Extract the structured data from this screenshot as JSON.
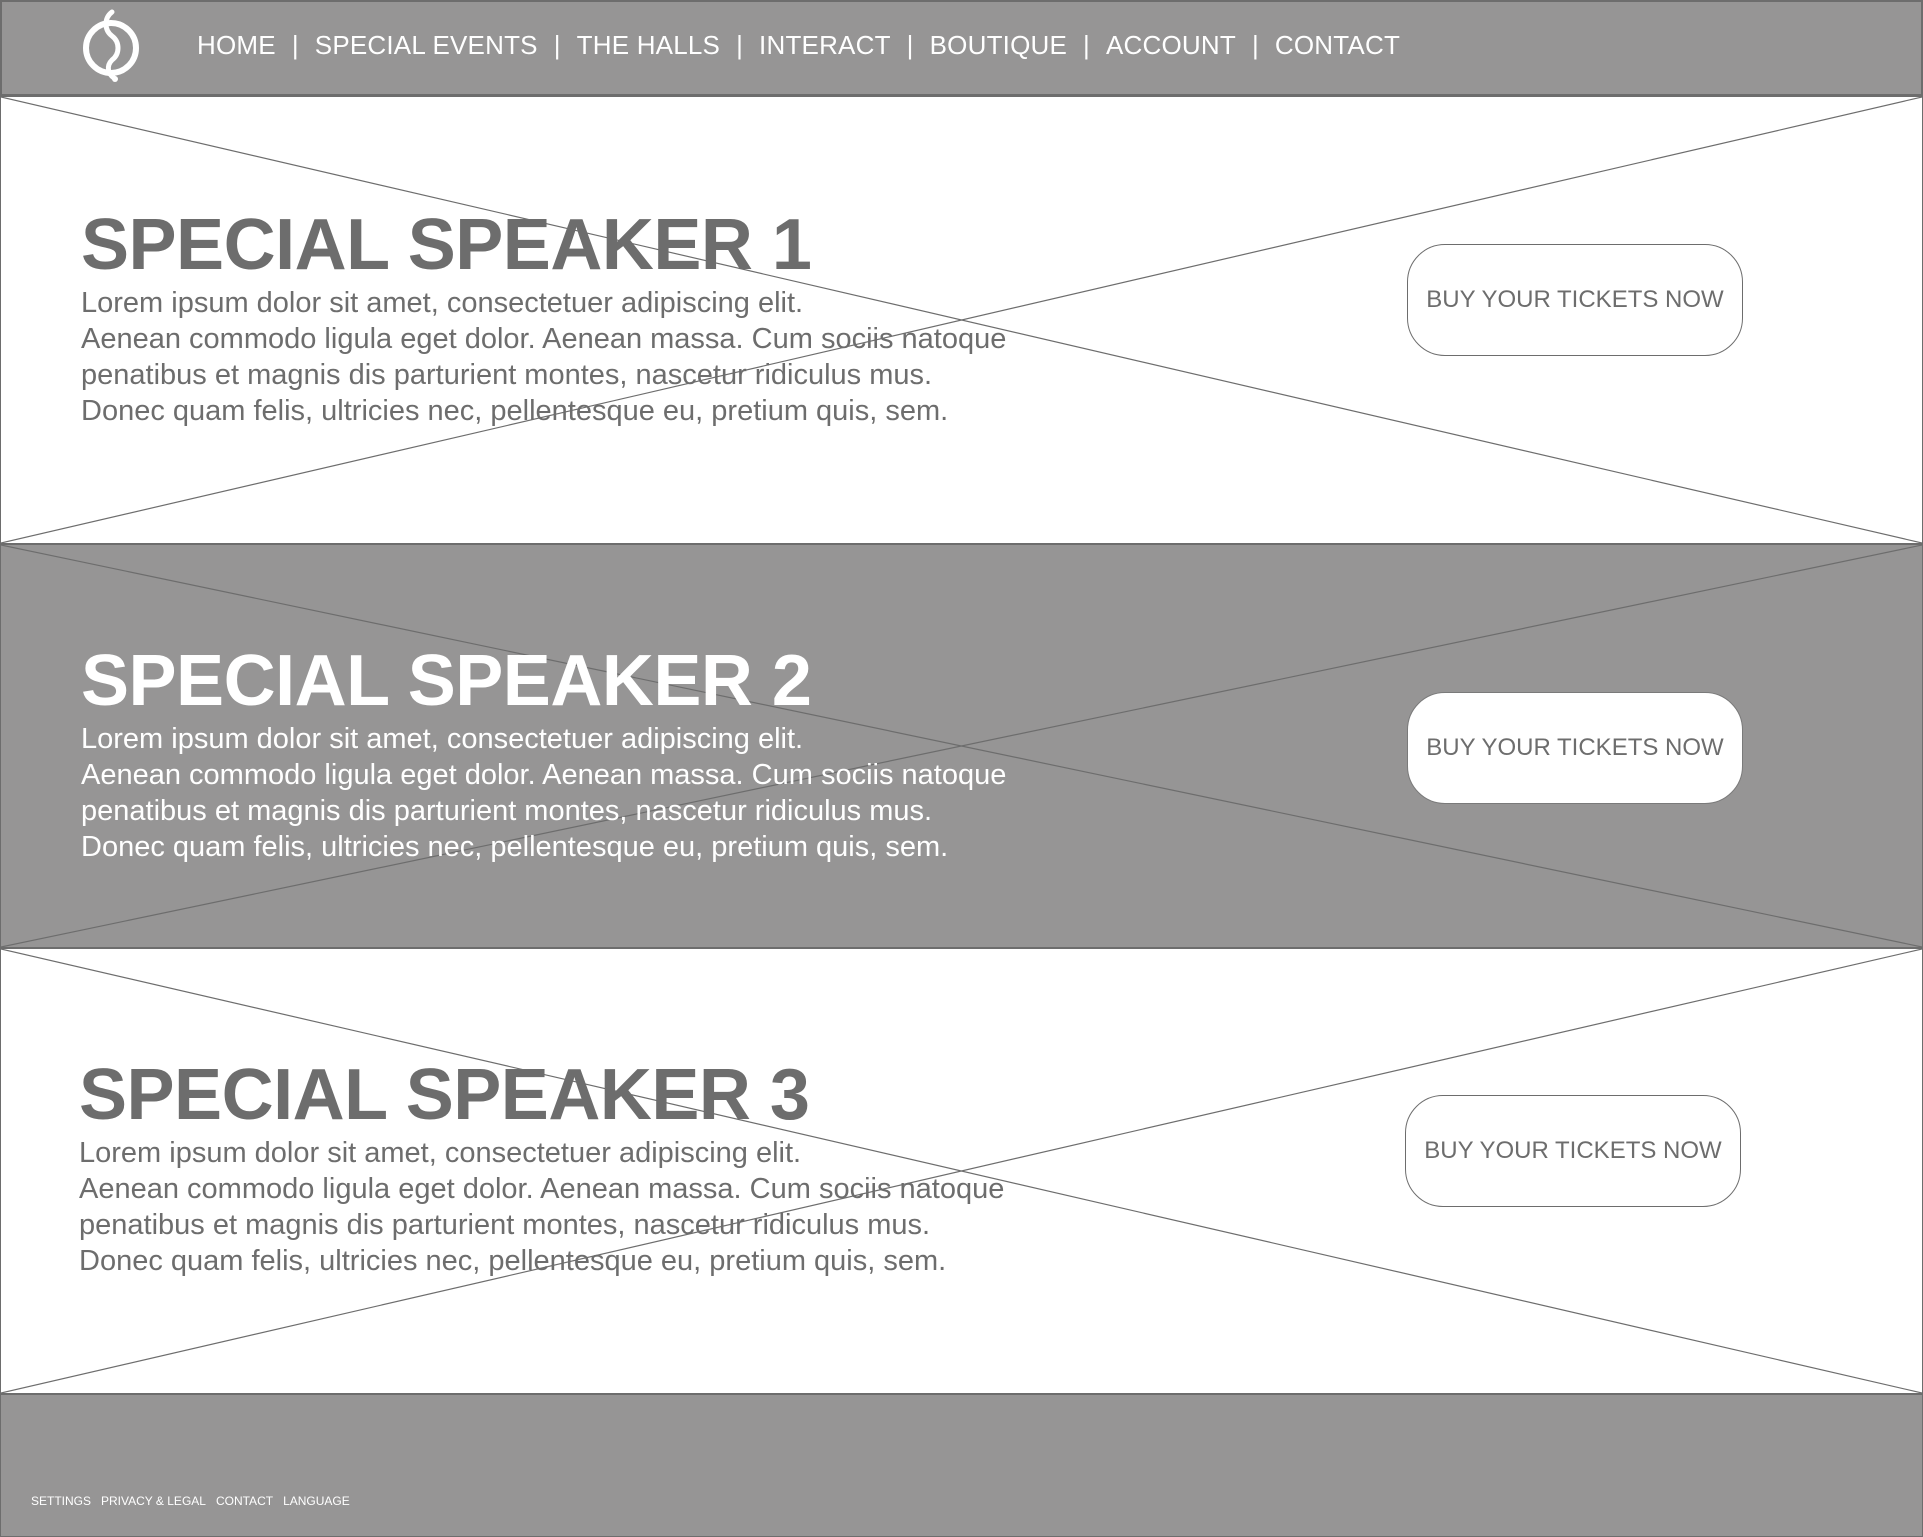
{
  "header": {
    "logo_name": "logo-icon",
    "nav": [
      {
        "label": "HOME"
      },
      {
        "label": "SPECIAL EVENTS"
      },
      {
        "label": "THE HALLS"
      },
      {
        "label": "INTERACT"
      },
      {
        "label": "BOUTIQUE"
      },
      {
        "label": "ACCOUNT"
      },
      {
        "label": "CONTACT"
      }
    ],
    "separator": "|"
  },
  "sections": [
    {
      "title": "SPECIAL SPEAKER 1",
      "body": "Lorem ipsum dolor sit amet, consectetuer adipiscing elit.\nAenean commodo ligula eget dolor. Aenean massa. Cum sociis natoque\npenatibus et magnis dis parturient montes, nascetur ridiculus mus.\nDonec quam felis, ultricies nec, pellentesque eu, pretium quis, sem.",
      "button_label": "BUY YOUR TICKETS NOW"
    },
    {
      "title": "SPECIAL SPEAKER 2",
      "body": "Lorem ipsum dolor sit amet, consectetuer adipiscing elit.\nAenean commodo ligula eget dolor. Aenean massa. Cum sociis natoque\npenatibus et magnis dis parturient montes, nascetur ridiculus mus.\nDonec quam felis, ultricies nec, pellentesque eu, pretium quis, sem.",
      "button_label": "BUY YOUR TICKETS NOW"
    },
    {
      "title": "SPECIAL SPEAKER 3",
      "body": "Lorem ipsum dolor sit amet, consectetuer adipiscing elit.\nAenean commodo ligula eget dolor. Aenean massa. Cum sociis natoque\npenatibus et magnis dis parturient montes, nascetur ridiculus mus.\nDonec quam felis, ultricies nec, pellentesque eu, pretium quis, sem.",
      "button_label": "BUY YOUR TICKETS NOW"
    }
  ],
  "footer": {
    "links": [
      {
        "label": "SETTINGS"
      },
      {
        "label": "PRIVACY & LEGAL"
      },
      {
        "label": "CONTACT"
      },
      {
        "label": "LANGUAGE"
      }
    ]
  },
  "colors": {
    "gray_bar": "#969595",
    "text_gray": "#6d6d6d",
    "white": "#ffffff"
  }
}
